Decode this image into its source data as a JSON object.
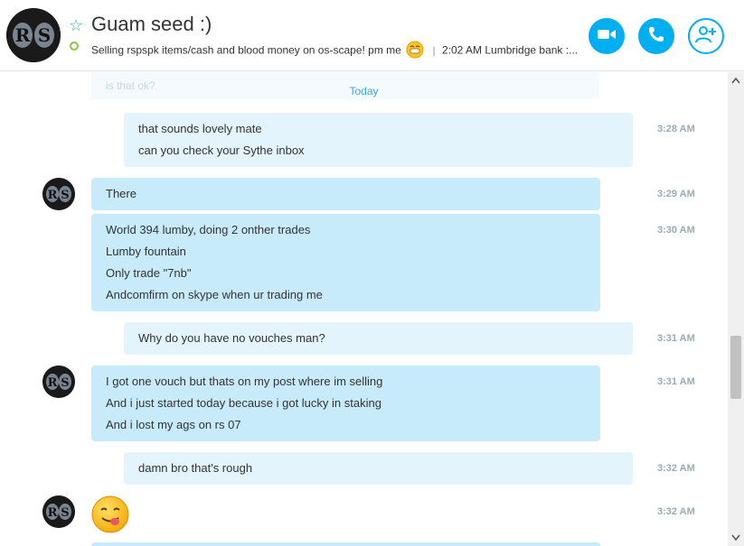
{
  "header": {
    "avatar_text": "RS",
    "title": "Guam seed :)",
    "mood_text": "Selling rspspk items/cash and blood money on os-scape!  pm me",
    "mood_extra": "2:02 AM Lumbridge bank :...",
    "separator": "|",
    "video_call_icon": "video-camera-icon",
    "call_icon": "phone-icon",
    "add_contact_icon": "add-person-icon"
  },
  "chat": {
    "faded_text": "is that ok?",
    "divider": "Today",
    "messages": [
      {
        "lines": [
          "that sounds lovely mate",
          "can you check your Sythe inbox"
        ],
        "time": "3:28 AM"
      },
      {
        "lines": [
          "There"
        ],
        "time": "3:29 AM"
      },
      {
        "lines": [
          "World 394 lumby, doing 2 onther trades",
          "Lumby fountain",
          "Only trade \"7nb\"",
          "Andcomfirm on skype when ur trading me"
        ],
        "time": "3:30 AM"
      },
      {
        "lines": [
          "Why do you have no vouches man?"
        ],
        "time": "3:31 AM"
      },
      {
        "lines": [
          "I got one vouch but thats on my post where im selling",
          "And i just started today because i got lucky in staking",
          "And i lost my ags on rs 07"
        ],
        "time": "3:31 AM"
      },
      {
        "lines": [
          "damn bro that's rough"
        ],
        "time": "3:32 AM"
      },
      {
        "emoji": "tongue-out-emoji",
        "time": "3:32 AM"
      }
    ]
  },
  "colors": {
    "accent": "#00aff0",
    "outgoing_bubble": "#e3f4fc",
    "incoming_bubble": "#c7ebfb",
    "timestamp": "#9aaab8",
    "presence": "#8cc63f"
  }
}
